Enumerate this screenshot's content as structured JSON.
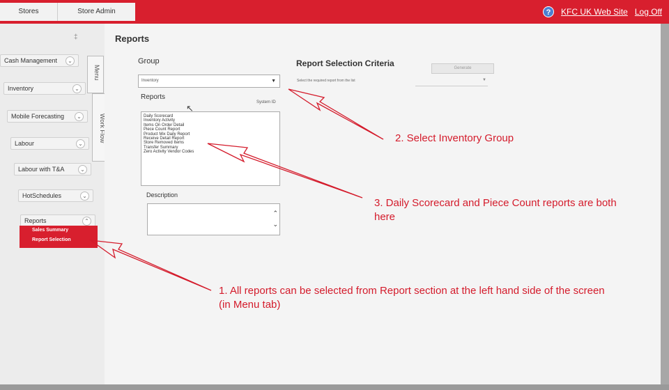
{
  "topbar": {
    "tabs": [
      "Stores",
      "Store Admin"
    ],
    "site_link": "KFC UK Web Site",
    "logout_link": "Log Off",
    "help_glyph": "?"
  },
  "sidebar": {
    "items": [
      {
        "label": "Cash Management"
      },
      {
        "label": "Inventory"
      },
      {
        "label": "Mobile Forecasting"
      },
      {
        "label": "Labour"
      },
      {
        "label": "Labour with T&A"
      },
      {
        "label": "HotSchedules"
      },
      {
        "label": "Reports"
      }
    ],
    "subitems": [
      "Sales Summary",
      "Report Selection"
    ],
    "vertical_tabs": [
      "Menu",
      "Work Flow"
    ]
  },
  "content": {
    "title": "Reports",
    "group_label": "Group",
    "group_value": "Inventory",
    "reports_label": "Reports",
    "system_id_label": "System ID",
    "reports": [
      "Daily Scorecard",
      "Inventory Activity",
      "Items On Order Detail",
      "Piece Count Report",
      "Product Mix Daily Report",
      "Receive Detail Report",
      "Store Removed Items",
      "Transfer Summary",
      "Zero Activity Vendor Codes"
    ],
    "description_label": "Description",
    "criteria_title": "Report Selection Criteria",
    "generate_label": "Generate",
    "criteria_hint": "Select the required report from the list"
  },
  "annotations": {
    "note1": "1. All reports can be selected from Report section at the left hand side of the screen (in Menu tab)",
    "note2": "2. Select Inventory Group",
    "note3": "3. Daily Scorecard and Piece Count reports are both here"
  },
  "colors": {
    "brand_red": "#d81f2e",
    "annotation_red": "#d41b2b"
  }
}
